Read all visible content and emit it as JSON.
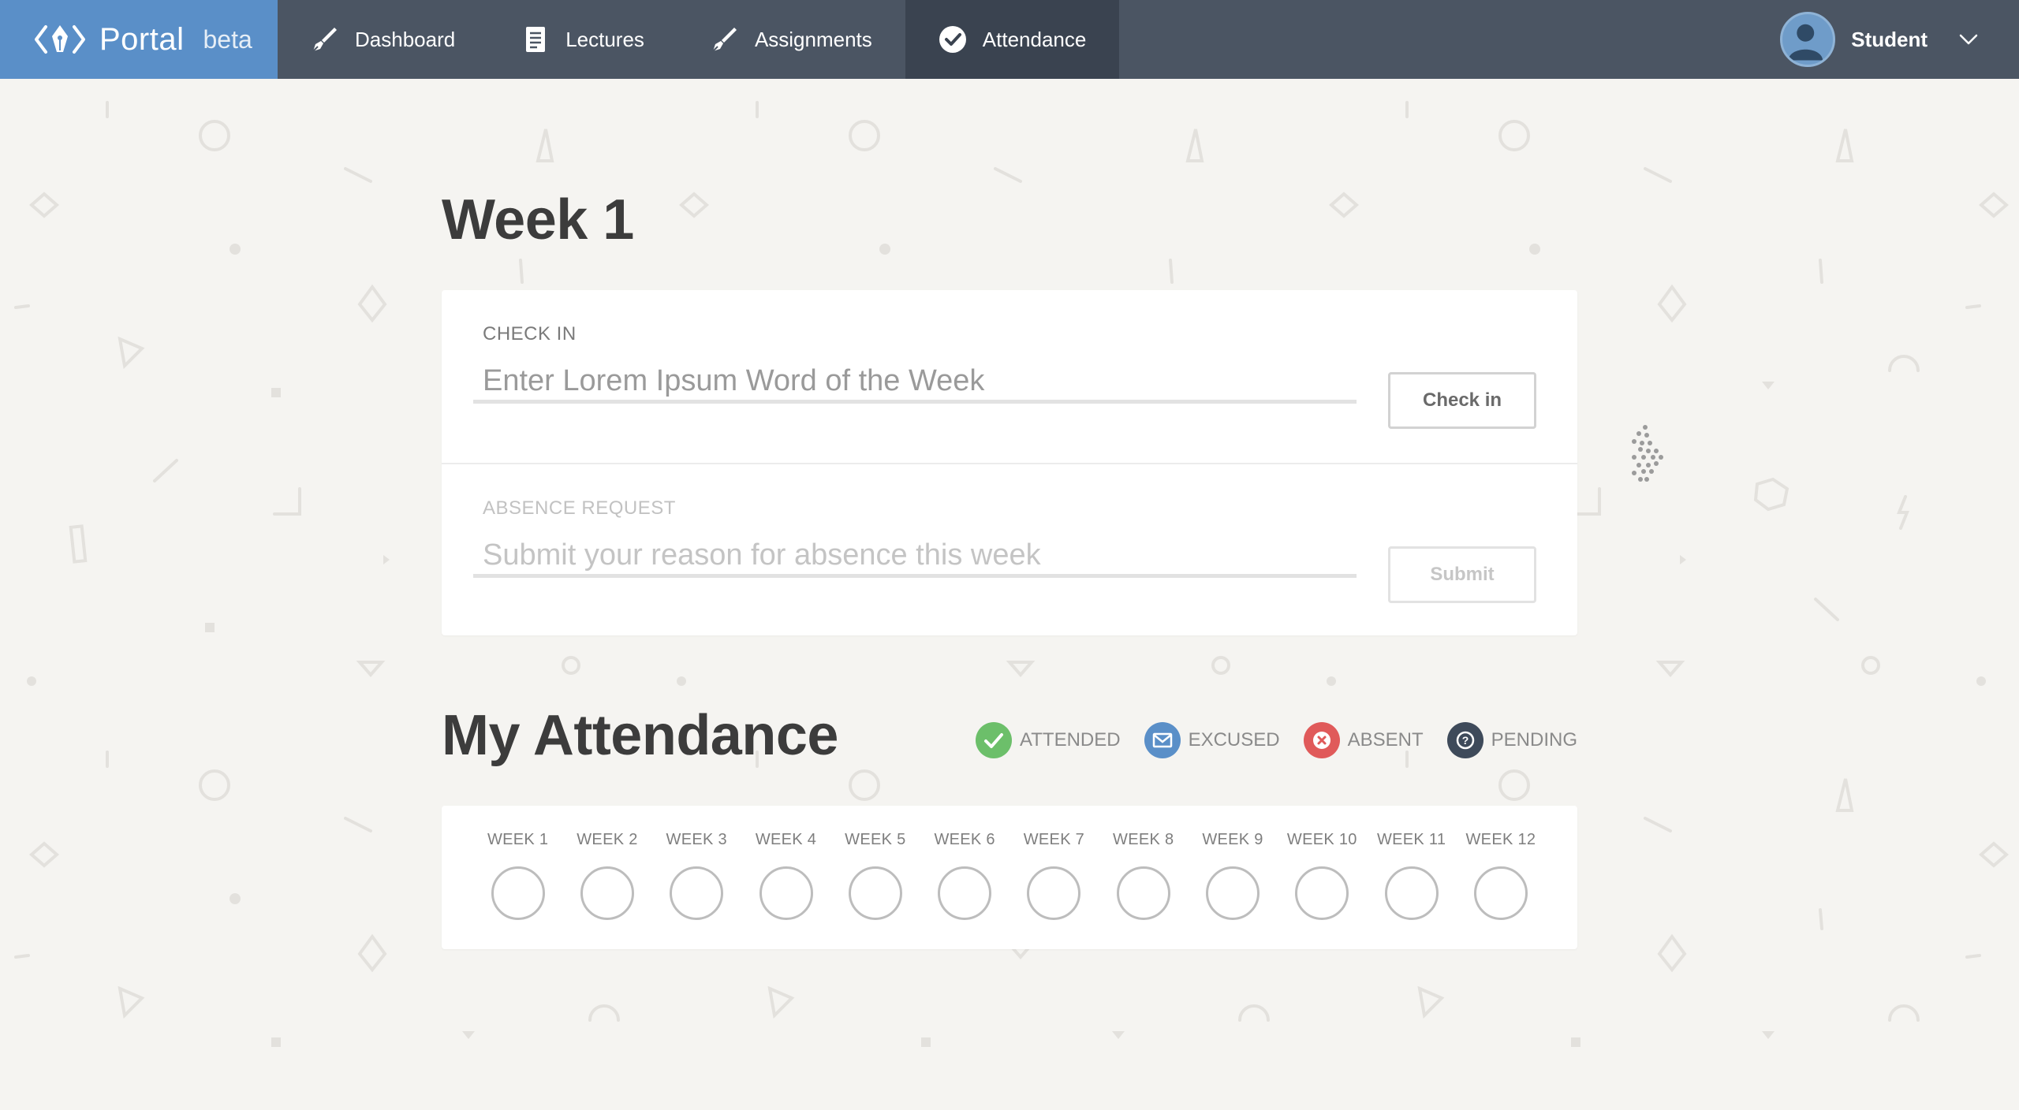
{
  "brand": {
    "name": "Portal",
    "badge": "beta"
  },
  "nav": {
    "items": [
      {
        "label": "Dashboard",
        "icon": "pen-nib-icon",
        "active": false
      },
      {
        "label": "Lectures",
        "icon": "document-icon",
        "active": false
      },
      {
        "label": "Assignments",
        "icon": "pen-nib-icon",
        "active": false
      },
      {
        "label": "Attendance",
        "icon": "check-circle-icon",
        "active": true
      }
    ]
  },
  "user": {
    "name": "Student",
    "avatar_icon": "user-avatar-icon"
  },
  "week": {
    "title": "Week 1"
  },
  "checkin": {
    "label": "CHECK IN",
    "placeholder": "Enter Lorem Ipsum Word of the Week",
    "value": "",
    "button": "Check in"
  },
  "absence": {
    "label": "ABSENCE REQUEST",
    "placeholder": "Submit your reason for absence this week",
    "value": "",
    "button": "Submit"
  },
  "attendance": {
    "title": "My Attendance",
    "legend": [
      {
        "label": "ATTENDED",
        "color": "#6cbf6a",
        "icon": "check-icon"
      },
      {
        "label": "EXCUSED",
        "color": "#5a8fc8",
        "icon": "envelope-icon"
      },
      {
        "label": "ABSENT",
        "color": "#e05a5a",
        "icon": "x-icon"
      },
      {
        "label": "PENDING",
        "color": "#3e4a5a",
        "icon": "question-icon"
      }
    ],
    "weeks": [
      "WEEK 1",
      "WEEK 2",
      "WEEK 3",
      "WEEK 4",
      "WEEK 5",
      "WEEK 6",
      "WEEK 7",
      "WEEK 8",
      "WEEK 9",
      "WEEK 10",
      "WEEK 11",
      "WEEK 12"
    ]
  },
  "colors": {
    "nav_bg": "#4b5563",
    "nav_active": "#3a4350",
    "brand_bg": "#5a8fc8",
    "page_bg": "#f5f4f1"
  }
}
